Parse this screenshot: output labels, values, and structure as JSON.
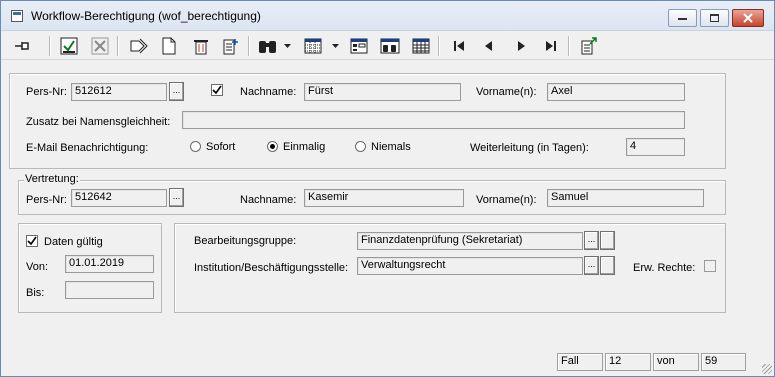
{
  "window": {
    "title": "Workflow-Berechtigung (wof_berechtigung)",
    "buttons": [
      "minimize",
      "maximize",
      "close"
    ]
  },
  "toolbar": {
    "icons": [
      "pin-icon",
      "save-icon",
      "cancel-icon",
      "copy-icon",
      "new-document-icon",
      "delete-icon",
      "insert-record-icon",
      "find-icon",
      "grid-view-icon",
      "form-view-icon",
      "filter-view-icon",
      "table-view-icon",
      "first-record-icon",
      "previous-record-icon",
      "next-record-icon",
      "last-record-icon",
      "export-icon"
    ]
  },
  "person": {
    "pers_nr_label": "Pers-Nr:",
    "pers_nr_value": "512612",
    "checkbox_checked": true,
    "nachname_label": "Nachname:",
    "nachname_value": "Fürst",
    "vorname_label": "Vorname(n):",
    "vorname_value": "Axel",
    "zusatz_label": "Zusatz bei Namensgleichheit:",
    "zusatz_value": "",
    "email_label": "E-Mail Benachrichtigung:",
    "email_options": [
      "Sofort",
      "Einmalig",
      "Niemals"
    ],
    "email_selected": "Einmalig",
    "weiterleitung_label": "Weiterleitung (in Tagen):",
    "weiterleitung_value": "4"
  },
  "vertretung": {
    "legend": "Vertretung:",
    "pers_nr_label": "Pers-Nr:",
    "pers_nr_value": "512642",
    "nachname_label": "Nachname:",
    "nachname_value": "Kasemir",
    "vorname_label": "Vorname(n):",
    "vorname_value": "Samuel"
  },
  "validity": {
    "daten_gueltig_label": "Daten gültig",
    "daten_gueltig_checked": true,
    "von_label": "Von:",
    "von_value": "01.01.2019",
    "bis_label": "Bis:",
    "bis_value": ""
  },
  "assignment": {
    "bearbeitungsgruppe_label": "Bearbeitungsgruppe:",
    "bearbeitungsgruppe_value": "Finanzdatenprüfung (Sekretariat)",
    "institution_label": "Institution/Beschäftigungsstelle:",
    "institution_value": "Verwaltungsrecht",
    "erw_rechte_label": "Erw. Rechte:",
    "erw_rechte_checked": false
  },
  "statusbar": {
    "fall_label": "Fall",
    "fall_value": "12",
    "von_label": "von",
    "total_value": "59"
  },
  "colors": {
    "window_bg": "#f0f0f0",
    "titlebar": "#dbe5f1",
    "close_button": "#c9442c"
  }
}
